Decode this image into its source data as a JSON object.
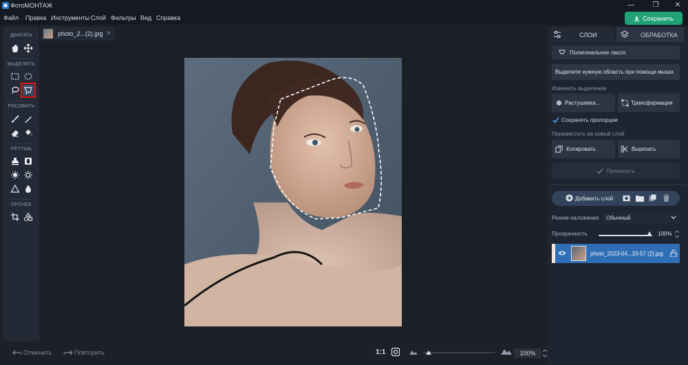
{
  "app": {
    "title": "ФотоМОНТАЖ"
  },
  "window": {
    "minimize": "—",
    "maximize": "❐",
    "close": "✕"
  },
  "menu": [
    "Файл",
    "Правка",
    "Инструменты",
    "Слой",
    "Фильтры",
    "Вид",
    "Справка"
  ],
  "save_button": "Сохранить",
  "tools": {
    "sections": [
      "ДВИГАТЬ",
      "ВЫДЕЛИТЬ",
      "РИСОВАТЬ",
      "РЕТУШЬ",
      "ПРОЧЕЕ"
    ],
    "active_tool": "polygonal-lasso"
  },
  "document_tab": {
    "name": "photo_2...(2).jpg",
    "close": "×"
  },
  "bottom": {
    "undo": "Отменить",
    "redo": "Повторить",
    "ratio": "1:1",
    "zoom": "100%",
    "zoom_slider_fraction": 0.05
  },
  "right_panel": {
    "tab_layers": "СЛОИ",
    "tab_processing": "ОБРАБОТКА",
    "tool_name": "Полигональное лассо",
    "hint": "Выделите нужную область при помощи мыши.",
    "change_selection_label": "Изменить выделение",
    "feather_button": "Растушевка...",
    "transform_button": "Трансформация",
    "keep_proportions": "Сохранять пропорции",
    "keep_proportions_checked": true,
    "move_to_layer_label": "Переместить на новый слой",
    "copy_button": "Копировать",
    "cut_button": "Вырезать",
    "apply_button": "Применить",
    "add_layer_button": "Добавить слой",
    "blend_mode_label": "Режим наложения:",
    "blend_mode_value": "Обычный",
    "opacity_label": "Прозрачность",
    "opacity_value": "100%",
    "opacity_fraction": 1.0,
    "layer_name": "photo_2023-04...33-57 (2).jpg"
  },
  "colors": {
    "accent_green": "#20a278",
    "selected_layer": "#2f6fb6",
    "active_tool_highlight": "#e11b1b"
  }
}
